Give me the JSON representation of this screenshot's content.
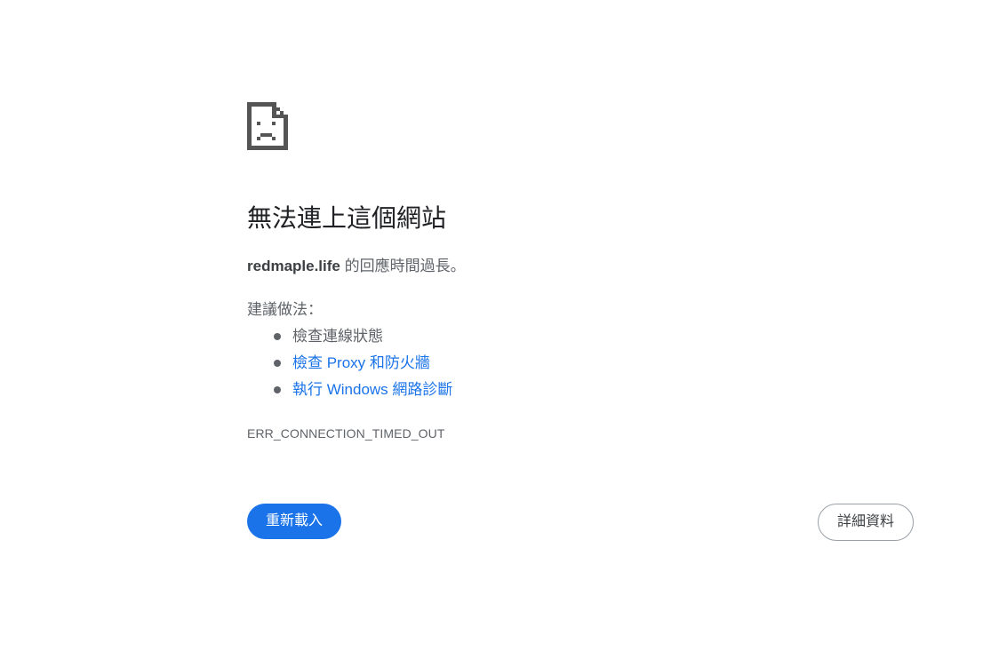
{
  "error_page": {
    "icon": "sad-document-icon",
    "title": "無法連上這個網站",
    "description": {
      "host": "redmaple.life",
      "message": " 的回應時間過長。"
    },
    "suggestions_heading": "建議做法：",
    "suggestions": [
      {
        "label": "檢查連線狀態",
        "is_link": false
      },
      {
        "label": "檢查 Proxy 和防火牆",
        "is_link": true
      },
      {
        "label": "執行 Windows 網路診斷",
        "is_link": true
      }
    ],
    "error_code": "ERR_CONNECTION_TIMED_OUT",
    "buttons": {
      "reload": "重新載入",
      "details": "詳細資料"
    }
  },
  "colors": {
    "primary": "#1a73e8",
    "text": "#3c4043",
    "secondary_text": "#5f6368"
  }
}
